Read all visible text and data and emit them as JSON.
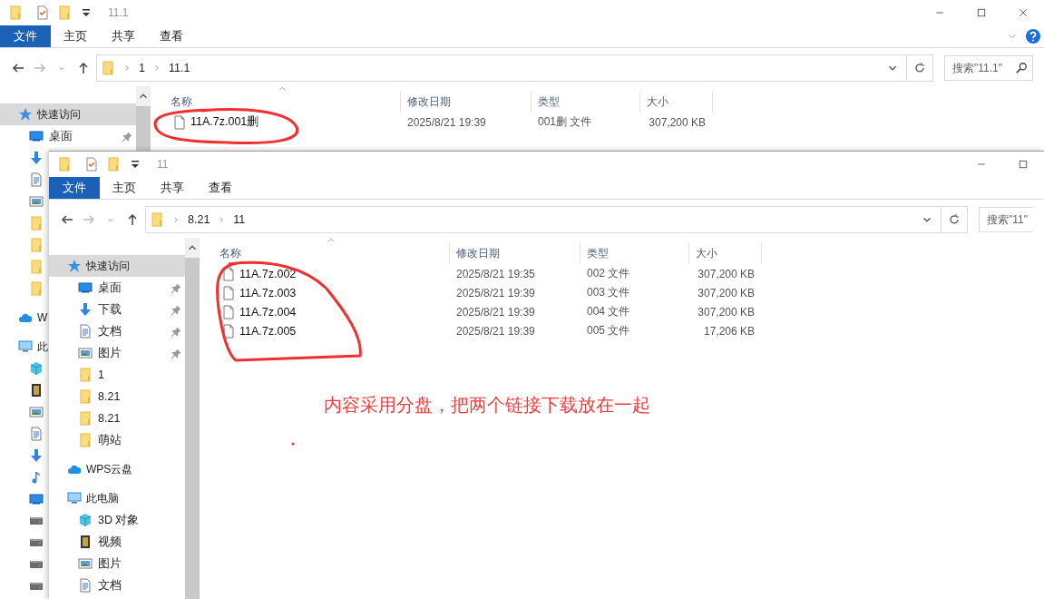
{
  "windows": [
    {
      "title": "11.1",
      "close_button": true,
      "file_menu": "文件",
      "ribbon_tabs": [
        "主页",
        "共享",
        "查看"
      ],
      "ribbon_help": true,
      "path": [
        "1",
        "11.1"
      ],
      "search": {
        "placeholder": "搜索\"11.1\"",
        "icon": true
      },
      "nav": [
        {
          "kind": "quick-access",
          "label": "快速访问",
          "selected": true,
          "children": [
            {
              "kind": "desktop",
              "label": "桌面",
              "pinned": true,
              "selected": false
            },
            {
              "kind": "downloads",
              "selected": false
            },
            {
              "kind": "documents",
              "selected": false
            },
            {
              "kind": "pictures",
              "selected": false
            },
            {
              "kind": "folder",
              "selected": false
            },
            {
              "kind": "folder",
              "selected": false
            },
            {
              "kind": "folder",
              "selected": false
            },
            {
              "kind": "folder",
              "selected": false
            }
          ]
        },
        {
          "kind": "cloud",
          "label": "W",
          "selected": false
        },
        {
          "kind": "this-pc",
          "label": "此",
          "selected": false,
          "children": [
            {
              "kind": "objects-3d",
              "selected": false
            },
            {
              "kind": "videos",
              "selected": false
            },
            {
              "kind": "pictures",
              "selected": false
            },
            {
              "kind": "documents",
              "selected": false
            },
            {
              "kind": "downloads",
              "selected": false
            },
            {
              "kind": "music",
              "selected": false
            },
            {
              "kind": "desktop",
              "selected": false
            },
            {
              "kind": "drive",
              "selected": false
            },
            {
              "kind": "drive",
              "selected": false
            },
            {
              "kind": "drive",
              "selected": false
            },
            {
              "kind": "drive",
              "selected": false
            }
          ]
        }
      ],
      "columns": [
        "名称",
        "修改日期",
        "类型",
        "大小"
      ],
      "rows": [
        {
          "name": "11A.7z.001删",
          "date": "2025/8/21 19:39",
          "type": "001删 文件",
          "size": "307,200 KB"
        }
      ]
    },
    {
      "title": "11",
      "close_button": false,
      "file_menu": "文件",
      "ribbon_tabs": [
        "主页",
        "共享",
        "查看"
      ],
      "ribbon_help": false,
      "path": [
        "8.21",
        "11"
      ],
      "search": {
        "placeholder": "搜索\"11\"",
        "icon": false
      },
      "nav": [
        {
          "kind": "quick-access",
          "label": "快速访问",
          "selected": true,
          "children": [
            {
              "kind": "desktop",
              "label": "桌面",
              "pinned": true,
              "selected": false
            },
            {
              "kind": "downloads",
              "label": "下载",
              "pinned": true,
              "selected": false
            },
            {
              "kind": "documents",
              "label": "文档",
              "pinned": true,
              "selected": false
            },
            {
              "kind": "pictures",
              "label": "图片",
              "pinned": true,
              "selected": false
            },
            {
              "kind": "folder",
              "label": "1",
              "pinned": false,
              "selected": false
            },
            {
              "kind": "folder",
              "label": "8.21",
              "pinned": false,
              "selected": false
            },
            {
              "kind": "folder",
              "label": "8.21",
              "pinned": false,
              "selected": false
            },
            {
              "kind": "folder",
              "label": "萌站",
              "pinned": false,
              "selected": false
            }
          ]
        },
        {
          "kind": "cloud",
          "label": "WPS云盘",
          "selected": false
        },
        {
          "kind": "this-pc",
          "label": "此电脑",
          "selected": false,
          "children": [
            {
              "kind": "objects-3d",
              "label": "3D 对象",
              "pinned": false,
              "selected": false
            },
            {
              "kind": "videos",
              "label": "视频",
              "pinned": false,
              "selected": false
            },
            {
              "kind": "pictures",
              "label": "图片",
              "pinned": false,
              "selected": false
            },
            {
              "kind": "documents",
              "label": "文档",
              "pinned": false,
              "selected": false
            }
          ]
        }
      ],
      "columns": [
        "名称",
        "修改日期",
        "类型",
        "大小"
      ],
      "rows": [
        {
          "name": "11A.7z.002",
          "date": "2025/8/21 19:35",
          "type": "002 文件",
          "size": "307,200 KB"
        },
        {
          "name": "11A.7z.003",
          "date": "2025/8/21 19:39",
          "type": "003 文件",
          "size": "307,200 KB"
        },
        {
          "name": "11A.7z.004",
          "date": "2025/8/21 19:39",
          "type": "004 文件",
          "size": "307,200 KB"
        },
        {
          "name": "11A.7z.005",
          "date": "2025/8/21 19:39",
          "type": "005 文件",
          "size": "17,206 KB"
        }
      ]
    }
  ],
  "annotation": {
    "text": "内容采用分盘，把两个链接下载放在一起"
  }
}
